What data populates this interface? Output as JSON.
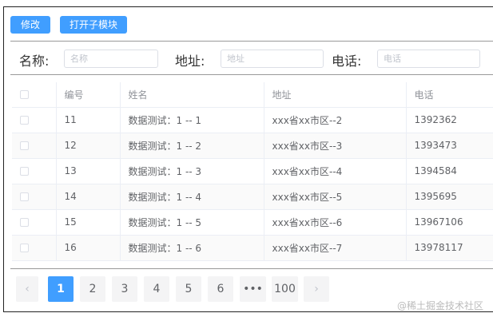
{
  "toolbar": {
    "edit": "修改",
    "open_sub": "打开子模块"
  },
  "search": {
    "name_label": "名称:",
    "name_placeholder": "名称",
    "name_value": "",
    "address_label": "地址:",
    "address_placeholder": "地址",
    "address_value": "",
    "phone_label": "电话:",
    "phone_placeholder": "电话",
    "phone_value": ""
  },
  "table": {
    "headers": [
      "编号",
      "姓名",
      "地址",
      "电话"
    ],
    "rows": [
      {
        "id": "11",
        "name": "数据测试：1 -- 1",
        "address": "xxx省xx市区--2",
        "phone": "1392362"
      },
      {
        "id": "12",
        "name": "数据测试：1 -- 2",
        "address": "xxx省xx市区--3",
        "phone": "1393473"
      },
      {
        "id": "13",
        "name": "数据测试：1 -- 3",
        "address": "xxx省xx市区--4",
        "phone": "1394584"
      },
      {
        "id": "14",
        "name": "数据测试：1 -- 4",
        "address": "xxx省xx市区--5",
        "phone": "1395695"
      },
      {
        "id": "15",
        "name": "数据测试：1 -- 5",
        "address": "xxx省xx市区--6",
        "phone": "13967106"
      },
      {
        "id": "16",
        "name": "数据测试：1 -- 6",
        "address": "xxx省xx市区--7",
        "phone": "13978117"
      }
    ]
  },
  "pagination": {
    "prev": "‹",
    "next": "›",
    "pages": [
      "1",
      "2",
      "3",
      "4",
      "5",
      "6",
      "•••",
      "100"
    ],
    "current": "1"
  },
  "watermark": "@稀土掘金技术社区"
}
